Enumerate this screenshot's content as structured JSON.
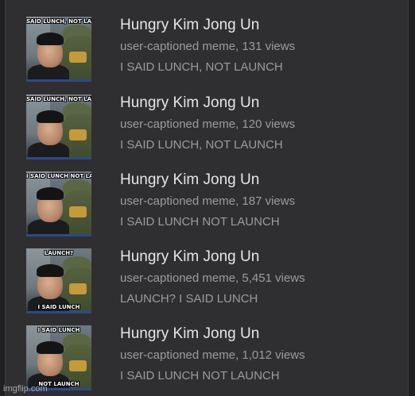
{
  "results": [
    {
      "title": "Hungry Kim Jong Un",
      "meta": "user-captioned meme, 131 views",
      "caption": "I SAID LUNCH, NOT LAUNCH",
      "thumb_top_text": "SAID LUNCH, NOT LAUNCH",
      "thumb_bottom_text": ""
    },
    {
      "title": "Hungry Kim Jong Un",
      "meta": "user-captioned meme, 120 views",
      "caption": "I SAID LUNCH, NOT LAUNCH",
      "thumb_top_text": "SAID LUNCH, NOT LAUNCH",
      "thumb_bottom_text": ""
    },
    {
      "title": "Hungry Kim Jong Un",
      "meta": "user-captioned meme, 187 views",
      "caption": "I SAID LUNCH NOT LAUNCH",
      "thumb_top_text": "I SAID LUNCH NOT LAUNCH",
      "thumb_bottom_text": ""
    },
    {
      "title": "Hungry Kim Jong Un",
      "meta": "user-captioned meme, 5,451 views",
      "caption": "LAUNCH? I SAID LUNCH",
      "thumb_top_text": "LAUNCH?",
      "thumb_bottom_text": "I SAID LUNCH"
    },
    {
      "title": "Hungry Kim Jong Un",
      "meta": "user-captioned meme, 1,012 views",
      "caption": "I SAID LUNCH NOT LAUNCH",
      "thumb_top_text": "I SAID LUNCH",
      "thumb_bottom_text": "NOT LAUNCH"
    }
  ],
  "watermark": "imgflip.com",
  "colors": {
    "panel_background": "#2f2f31",
    "title_text": "#e6e6e6",
    "secondary_text": "#9c9c9c"
  }
}
